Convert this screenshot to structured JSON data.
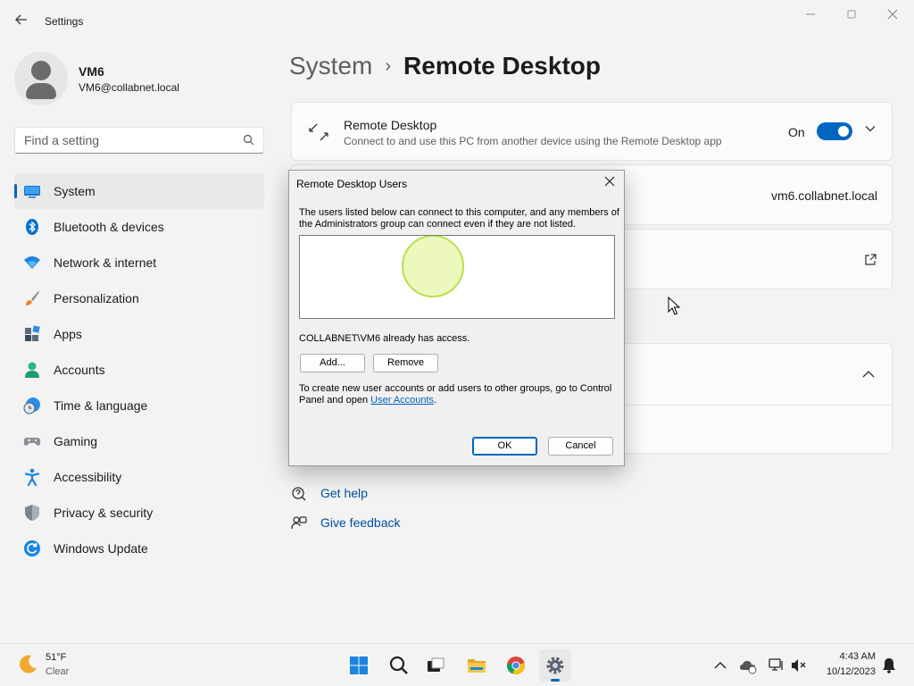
{
  "window": {
    "title": "Settings",
    "back_icon": "arrow-left-icon",
    "minimize_icon": "minimize-icon",
    "maximize_icon": "maximize-icon",
    "close_icon": "close-icon"
  },
  "user": {
    "name": "VM6",
    "email": "VM6@collabnet.local"
  },
  "search": {
    "placeholder": "Find a setting",
    "icon": "search-icon"
  },
  "sidebar": {
    "items": [
      {
        "label": "System",
        "icon": "system-icon",
        "active": true
      },
      {
        "label": "Bluetooth & devices",
        "icon": "bluetooth-icon"
      },
      {
        "label": "Network & internet",
        "icon": "wifi-icon"
      },
      {
        "label": "Personalization",
        "icon": "brush-icon"
      },
      {
        "label": "Apps",
        "icon": "apps-icon"
      },
      {
        "label": "Accounts",
        "icon": "accounts-icon"
      },
      {
        "label": "Time & language",
        "icon": "time-language-icon"
      },
      {
        "label": "Gaming",
        "icon": "gamepad-icon"
      },
      {
        "label": "Accessibility",
        "icon": "accessibility-icon"
      },
      {
        "label": "Privacy & security",
        "icon": "shield-icon"
      },
      {
        "label": "Windows Update",
        "icon": "update-icon"
      }
    ]
  },
  "breadcrumb": {
    "parent": "System",
    "separator": "›",
    "current": "Remote Desktop"
  },
  "remote_desktop": {
    "title": "Remote Desktop",
    "description": "Connect to and use this PC from another device using the Remote Desktop app",
    "state_label": "On",
    "enabled": true
  },
  "pc_name": "vm6.collabnet.local",
  "help": {
    "get_help": "Get help",
    "give_feedback": "Give feedback"
  },
  "dialog": {
    "title": "Remote Desktop Users",
    "intro": "The users listed below can connect to this computer, and any members of the Administrators group can connect even if they are not listed.",
    "access_text": "COLLABNET\\VM6 already has access.",
    "add_label": "Add...",
    "remove_label": "Remove",
    "info_prefix": "To create new user accounts or add users to other groups, go to Control Panel and open ",
    "info_link": "User Accounts",
    "info_suffix": ".",
    "ok_label": "OK",
    "cancel_label": "Cancel"
  },
  "taskbar": {
    "weather_temp": "51°F",
    "weather_desc": "Clear",
    "apps": [
      {
        "name": "start",
        "icon": "windows-start-icon"
      },
      {
        "name": "search",
        "icon": "search-icon"
      },
      {
        "name": "task-view",
        "icon": "task-view-icon"
      },
      {
        "name": "file-explorer",
        "icon": "folder-icon"
      },
      {
        "name": "chrome",
        "icon": "chrome-icon"
      },
      {
        "name": "settings",
        "icon": "gear-icon",
        "active": true
      }
    ],
    "clock_time": "4:43 AM",
    "clock_date": "10/12/2023"
  },
  "colors": {
    "accent": "#0067c0",
    "background": "#f3f3f3",
    "card": "#fbfbfb",
    "dialog": "#f0f0f0"
  }
}
